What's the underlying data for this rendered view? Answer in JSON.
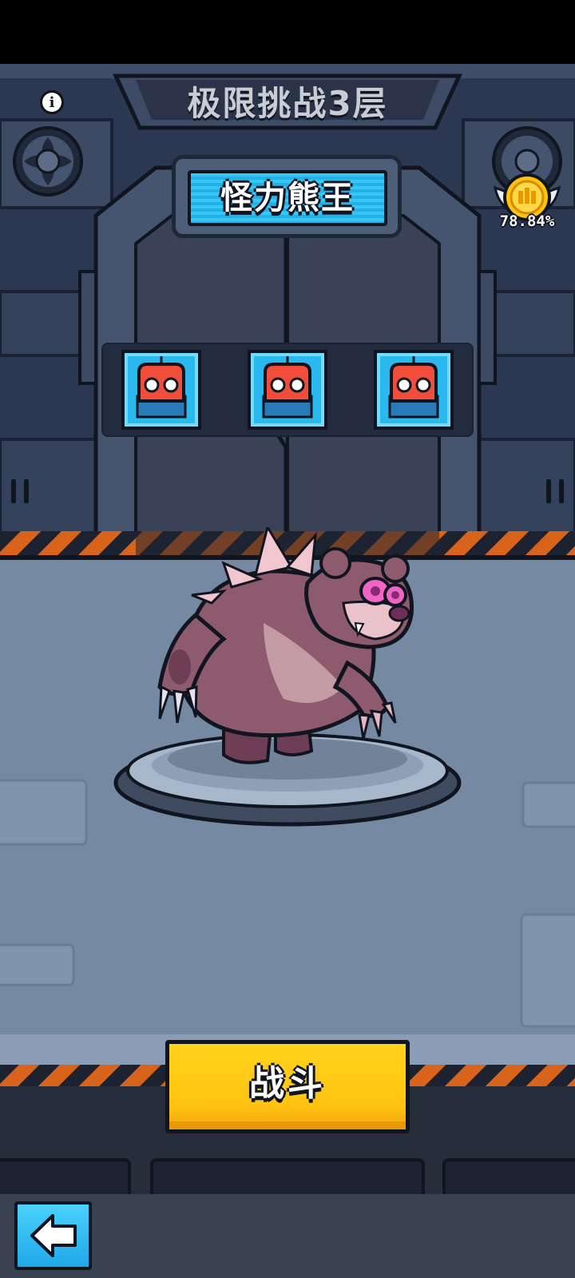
{
  "game": {
    "title": "极限挑战3层",
    "boss_name": "怪力熊王",
    "reward": {
      "icon": "gold-medal-icon",
      "percent_text": "78.84%"
    },
    "enemy_slots": [
      {
        "icon": "red-robot-icon"
      },
      {
        "icon": "red-robot-icon"
      },
      {
        "icon": "red-robot-icon"
      }
    ],
    "boss_character": "purple-bear-king",
    "battle_button_label": "战斗",
    "back_button_icon": "back-arrow-icon",
    "info_icon": "info-icon"
  },
  "colors": {
    "title_text": "#c8ccd4",
    "boss_plate": "#2bb8ee",
    "battle_button": "#ffc412",
    "hazard_orange": "#d8631a",
    "floor": "#7589a3",
    "bear_body": "#8e5a6e",
    "bear_eyes": "#f065c4"
  }
}
